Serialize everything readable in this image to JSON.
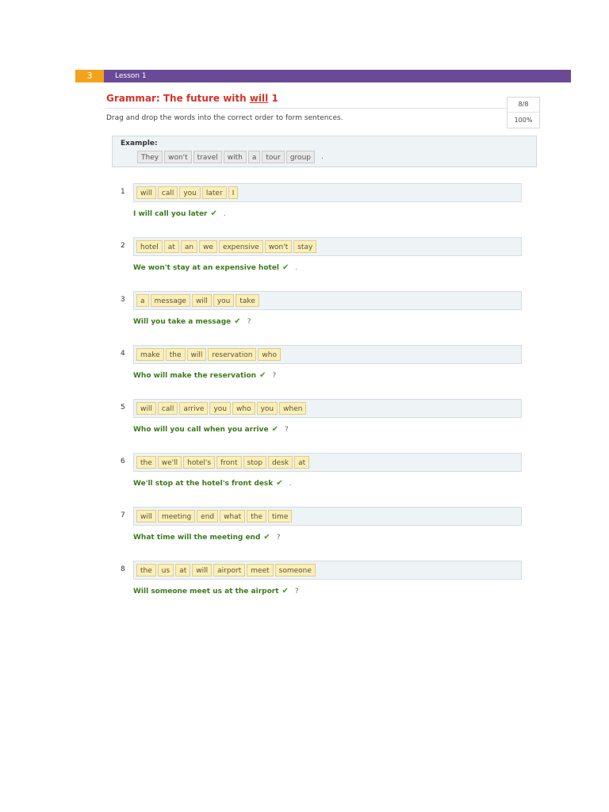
{
  "lesson": {
    "number": "3",
    "label": "Lesson 1"
  },
  "title": {
    "before": "Grammar: The future with ",
    "underlined": "will",
    "after": " 1"
  },
  "instructions": "Drag and drop the words into the correct order to form sentences.",
  "score": {
    "fraction": "8/8",
    "percent": "100%"
  },
  "example": {
    "label": "Example:",
    "words": [
      "They",
      "won't",
      "travel",
      "with",
      "a",
      "tour",
      "group"
    ],
    "end_punct": "."
  },
  "icons": {
    "check": "check-icon"
  },
  "colors": {
    "lesson_bar": "#6a4a97",
    "lesson_number": "#f2a31b",
    "title": "#d9322b",
    "answer": "#3e7a1e"
  },
  "items": [
    {
      "num": "1",
      "words": [
        "will",
        "call",
        "you",
        "later",
        "I"
      ],
      "answer": "I will call you later",
      "punct": "."
    },
    {
      "num": "2",
      "words": [
        "hotel",
        "at",
        "an",
        "we",
        "expensive",
        "won't",
        "stay"
      ],
      "answer": "We won't stay at an expensive hotel",
      "punct": "."
    },
    {
      "num": "3",
      "words": [
        "a",
        "message",
        "will",
        "you",
        "take"
      ],
      "answer": "Will you take a message",
      "punct": "?"
    },
    {
      "num": "4",
      "words": [
        "make",
        "the",
        "will",
        "reservation",
        "who"
      ],
      "answer": "Who will make the reservation",
      "punct": "?"
    },
    {
      "num": "5",
      "words": [
        "will",
        "call",
        "arrive",
        "you",
        "who",
        "you",
        "when"
      ],
      "answer": "Who will you call when you arrive",
      "punct": "?"
    },
    {
      "num": "6",
      "words": [
        "the",
        "we'll",
        "hotel's",
        "front",
        "stop",
        "desk",
        "at"
      ],
      "answer": "We'll stop at the hotel's front desk",
      "punct": "."
    },
    {
      "num": "7",
      "words": [
        "will",
        "meeting",
        "end",
        "what",
        "the",
        "time"
      ],
      "answer": "What time will the meeting end",
      "punct": "?"
    },
    {
      "num": "8",
      "words": [
        "the",
        "us",
        "at",
        "will",
        "airport",
        "meet",
        "someone"
      ],
      "answer": "Will someone meet us at the airport",
      "punct": "?"
    }
  ]
}
